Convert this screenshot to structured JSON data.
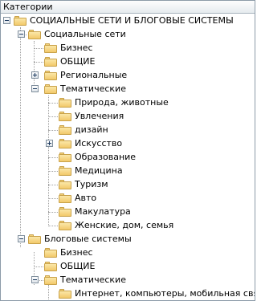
{
  "header": {
    "title": "Категории"
  },
  "tree": {
    "root": {
      "label": "СОЦИАЛЬНЫЕ СЕТИ И БЛОГОВЫЕ СИСТЕМЫ",
      "expanded": true
    },
    "social": {
      "label": "Социальные сети",
      "expanded": true,
      "children": {
        "business": "Бизнес",
        "general": "ОБЩИЕ",
        "regional": "Региональные",
        "thematic": "Тематические"
      },
      "thematic_children": [
        "Природа, животные",
        "Увлечения",
        "дизайн",
        "Искусство",
        "Образование",
        "Медицина",
        "Туризм",
        "Авто",
        "Макулатура",
        "Женские, дом, семья"
      ]
    },
    "blogs": {
      "label": "Блоговые системы",
      "expanded": true,
      "children": {
        "business": "Бизнес",
        "general": "ОБЩИЕ",
        "thematic": "Тематические"
      },
      "thematic_children": [
        "Интернет, компьютеры, мобильная связь"
      ]
    }
  },
  "colors": {
    "folder_fill": "#f2c96a",
    "folder_border": "#c9a24a",
    "panel_border": "#8c9ba8",
    "header_bg": "#e6ebef"
  }
}
